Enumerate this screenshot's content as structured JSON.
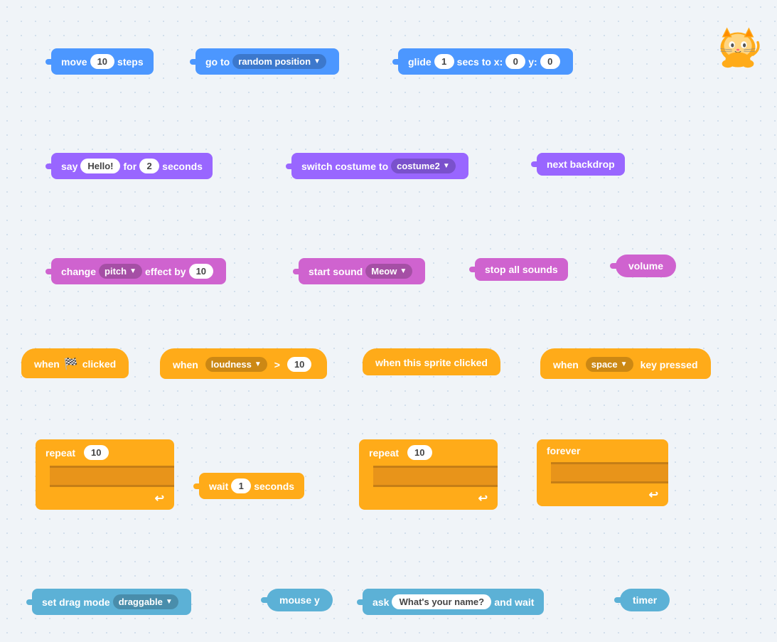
{
  "blocks": {
    "motion1": {
      "label": "move",
      "value": "10",
      "suffix": "steps"
    },
    "motion2": {
      "label": "go to",
      "dropdown": "random position"
    },
    "motion3": {
      "label": "glide",
      "val1": "1",
      "mid": "secs to x:",
      "val2": "0",
      "mid2": "y:",
      "val3": "0"
    },
    "looks1": {
      "label": "say",
      "value": "Hello!",
      "mid": "for",
      "val2": "2",
      "suffix": "seconds"
    },
    "looks2": {
      "label": "switch costume to",
      "dropdown": "costume2"
    },
    "looks3": {
      "label": "next backdrop"
    },
    "sound1": {
      "label": "change",
      "dropdown": "pitch",
      "mid": "effect by",
      "value": "10"
    },
    "sound2": {
      "label": "start sound",
      "dropdown": "Meow"
    },
    "sound3": {
      "label": "stop all sounds"
    },
    "sound4": {
      "label": "volume"
    },
    "event1": {
      "label1": "when",
      "flag": "🏴",
      "label2": "clicked"
    },
    "event2": {
      "label1": "when",
      "dropdown": "loudness",
      "op": ">",
      "value": "10"
    },
    "event3": {
      "label": "when this sprite clicked"
    },
    "event4": {
      "label1": "when",
      "dropdown": "space",
      "label2": "key pressed"
    },
    "control1": {
      "label": "repeat",
      "value": "10"
    },
    "control2": {
      "label": "wait",
      "value": "1",
      "suffix": "seconds"
    },
    "control3": {
      "label": "repeat",
      "value": "10"
    },
    "control4": {
      "label": "forever"
    },
    "sensing1": {
      "label": "set drag mode",
      "dropdown": "draggable"
    },
    "sensing2": {
      "label": "mouse y"
    },
    "sensing3": {
      "label1": "ask",
      "value": "What's your name?",
      "label2": "and wait"
    },
    "sensing4": {
      "label": "timer"
    }
  }
}
